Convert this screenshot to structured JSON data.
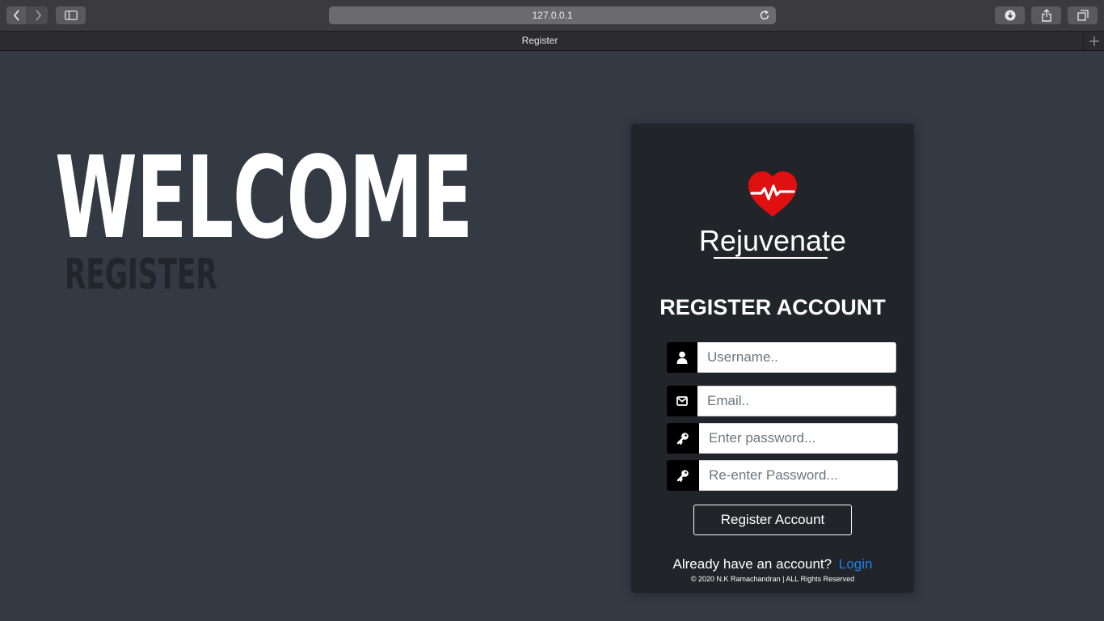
{
  "browser": {
    "url": "127.0.0.1",
    "tab_title": "Register"
  },
  "hero": {
    "heading": "WELCOME",
    "subheading": "REGISTER"
  },
  "card": {
    "brand": "Rejuvenate",
    "title": "REGISTER ACCOUNT",
    "fields": {
      "username_placeholder": "Username..",
      "email_placeholder": "Email..",
      "password_placeholder": "Enter password...",
      "repassword_placeholder": "Re-enter Password..."
    },
    "submit_label": "Register Account",
    "login_prompt": "Already have an account?",
    "login_link": "Login",
    "copyright": "© 2020 N.K Ramachandran | ALL Rights Reserved"
  },
  "colors": {
    "page_bg": "#343a44",
    "card_bg": "#212428",
    "heart": "#e01010",
    "link": "#1a82f0"
  },
  "icons": {
    "logo": "heart-pulse-icon",
    "username": "user-icon",
    "email": "envelope-icon",
    "password": "key-icon"
  }
}
